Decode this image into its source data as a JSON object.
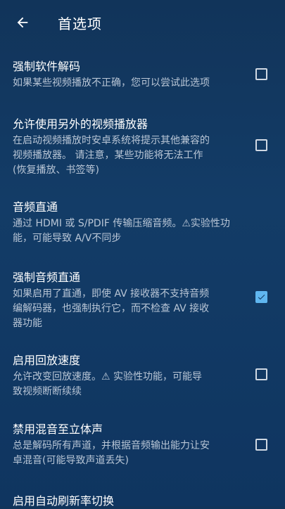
{
  "header": {
    "title": "首选项",
    "back_icon": "arrow-left-icon"
  },
  "colors": {
    "background": "#133c67",
    "accent": "#5fb6f0",
    "summary_text": "#b9c6d6"
  },
  "settings": [
    {
      "title": "强制软件解码",
      "summary": [
        "如果某些视频播放不正确，您可以尝试此选项"
      ],
      "checked": false
    },
    {
      "title": "允许使用另外的视频播放器",
      "summary": [
        "在启动视频播放时安卓系统将提示其他兼容的",
        "视频播放器。 请注意，某些功能将无法工作",
        "(恢复播放、书签等)"
      ],
      "checked": false
    },
    {
      "title": "音频直通",
      "summary": [
        "通过 HDMI 或 S/PDIF 传输压缩音频。⚠实验性功",
        "能，可能导致 A/V不同步"
      ],
      "checked": null
    },
    {
      "title": "强制音频直通",
      "summary": [
        "如果启用了直通，即使 AV 接收器不支持音频",
        "编解码器，也强制执行它，而不检查 AV 接收",
        "器功能"
      ],
      "checked": true
    },
    {
      "title": "启用回放速度",
      "summary": [
        "允许改变回放速度。⚠ 实验性功能，可能导",
        "致视频断断续续"
      ],
      "checked": false
    },
    {
      "title": "禁用混音至立体声",
      "summary": [
        "总是解码所有声道，并根据音频输出能力让安",
        "卓混音(可能导致声道丢失)"
      ],
      "checked": false
    },
    {
      "title": "启用自动刷新率切换",
      "summary": [],
      "checked": null
    }
  ]
}
